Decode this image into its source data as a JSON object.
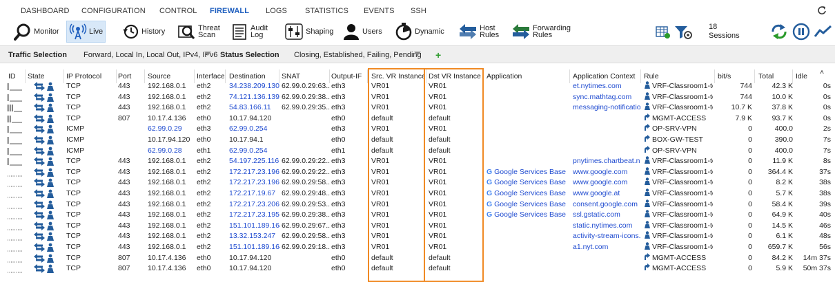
{
  "nav": {
    "items": [
      "DASHBOARD",
      "CONFIGURATION",
      "CONTROL",
      "FIREWALL",
      "LOGS",
      "STATISTICS",
      "EVENTS",
      "SSH"
    ],
    "active": "FIREWALL"
  },
  "toolbar": {
    "monitor": "Monitor",
    "live": "Live",
    "history": "History",
    "threat_scan_1": "Threat",
    "threat_scan_2": "Scan",
    "audit_log_1": "Audit",
    "audit_log_2": "Log",
    "shaping": "Shaping",
    "users": "Users",
    "dynamic": "Dynamic",
    "host_rules_1": "Host",
    "host_rules_2": "Rules",
    "forwarding_rules_1": "Forwarding",
    "forwarding_rules_2": "Rules",
    "sessions_count": "18",
    "sessions_label": "Sessions"
  },
  "filters": {
    "traffic_label": "Traffic Selection",
    "traffic_value": "Forward, Local In, Local Out, IPv4, IPv6",
    "status_label": "Status Selection",
    "status_value": "Closing, Established, Failing, Pending",
    "add": "+"
  },
  "columns": [
    "ID",
    "State",
    "IP Protocol",
    "Port",
    "Source",
    "Interface",
    "Destination",
    "SNAT",
    "Output-IF",
    "Src. VR Instance",
    "Dst VR Instance",
    "Application",
    "Application Context",
    "Rule",
    "bit/s",
    "Total",
    "Idle"
  ],
  "colors": {
    "accent_blue": "#1f4bd0",
    "highlight_orange": "#f08a24",
    "nav_active": "#1f5fbf"
  },
  "rows": [
    {
      "id_bars": 1,
      "proto": "TCP",
      "port": "443",
      "src": "192.168.0.1",
      "src_blue": false,
      "iface": "eth2",
      "dst": "34.238.209.130",
      "dst_blue": true,
      "snat": "62.99.0.29:63...",
      "out": "eth3",
      "srcvr": "VR01",
      "dstvr": "VR01",
      "app": "",
      "ctx": "et.nytimes.com",
      "rule": "VRF-Classroom1-to-I...",
      "rule_icon": "person",
      "bits": "744",
      "total": "42.3 K",
      "idle": "0s"
    },
    {
      "id_bars": 1,
      "proto": "TCP",
      "port": "443",
      "src": "192.168.0.1",
      "src_blue": false,
      "iface": "eth2",
      "dst": "74.121.136.139",
      "dst_blue": true,
      "snat": "62.99.0.29:38...",
      "out": "eth3",
      "srcvr": "VR01",
      "dstvr": "VR01",
      "app": "",
      "ctx": "sync.mathtag.com",
      "rule": "VRF-Classroom1-to-I...",
      "rule_icon": "person",
      "bits": "744",
      "total": "10.0 K",
      "idle": "0s"
    },
    {
      "id_bars": 3,
      "proto": "TCP",
      "port": "443",
      "src": "192.168.0.1",
      "src_blue": false,
      "iface": "eth2",
      "dst": "54.83.166.11",
      "dst_blue": true,
      "snat": "62.99.0.29:35...",
      "out": "eth3",
      "srcvr": "VR01",
      "dstvr": "VR01",
      "app": "",
      "ctx": "messaging-notification...",
      "rule": "VRF-Classroom1-to-I...",
      "rule_icon": "person",
      "bits": "10.7 K",
      "total": "37.8 K",
      "idle": "0s"
    },
    {
      "id_bars": 2,
      "proto": "TCP",
      "port": "807",
      "src": "10.17.4.136",
      "src_blue": false,
      "iface": "eth0",
      "dst": "10.17.94.120",
      "dst_blue": false,
      "snat": "",
      "out": "eth0",
      "srcvr": "default",
      "dstvr": "default",
      "app": "",
      "ctx": "",
      "rule": "MGMT-ACCESS",
      "rule_icon": "arrow",
      "bits": "7.9 K",
      "total": "93.7 K",
      "idle": "0s"
    },
    {
      "id_bars": 1,
      "proto": "ICMP",
      "port": "",
      "src": "62.99.0.29",
      "src_blue": true,
      "iface": "eth3",
      "dst": "62.99.0.254",
      "dst_blue": true,
      "snat": "",
      "out": "eth3",
      "srcvr": "VR01",
      "dstvr": "VR01",
      "app": "",
      "ctx": "",
      "rule": "OP-SRV-VPN",
      "rule_icon": "arrow",
      "bits": "0",
      "total": "400.0",
      "idle": "2s"
    },
    {
      "id_bars": 1,
      "proto": "ICMP",
      "port": "",
      "src": "10.17.94.120",
      "src_blue": false,
      "iface": "eth0",
      "dst": "10.17.94.1",
      "dst_blue": false,
      "snat": "",
      "out": "eth0",
      "srcvr": "default",
      "dstvr": "default",
      "app": "",
      "ctx": "",
      "rule": "BOX-GW-TEST",
      "rule_icon": "arrow",
      "bits": "0",
      "total": "390.0",
      "idle": "7s"
    },
    {
      "id_bars": 1,
      "proto": "ICMP",
      "port": "",
      "src": "62.99.0.28",
      "src_blue": true,
      "iface": "eth1",
      "dst": "62.99.0.254",
      "dst_blue": true,
      "snat": "",
      "out": "eth1",
      "srcvr": "default",
      "dstvr": "default",
      "app": "",
      "ctx": "",
      "rule": "OP-SRV-VPN",
      "rule_icon": "arrow",
      "bits": "0",
      "total": "400.0",
      "idle": "7s"
    },
    {
      "id_bars": 1,
      "proto": "TCP",
      "port": "443",
      "src": "192.168.0.1",
      "src_blue": false,
      "iface": "eth2",
      "dst": "54.197.225.116",
      "dst_blue": true,
      "snat": "62.99.0.29:22...",
      "out": "eth3",
      "srcvr": "VR01",
      "dstvr": "VR01",
      "app": "",
      "ctx": "pnytimes.chartbeat.net",
      "rule": "VRF-Classroom1-to-I...",
      "rule_icon": "person",
      "bits": "0",
      "total": "11.9 K",
      "idle": "8s"
    },
    {
      "id_bars": 0,
      "proto": "TCP",
      "port": "443",
      "src": "192.168.0.1",
      "src_blue": false,
      "iface": "eth2",
      "dst": "172.217.23.196",
      "dst_blue": true,
      "snat": "62.99.0.29:22...",
      "out": "eth3",
      "srcvr": "VR01",
      "dstvr": "VR01",
      "app": "Google Services Base",
      "ctx": "www.google.com",
      "rule": "VRF-Classroom1-to-I...",
      "rule_icon": "person",
      "bits": "0",
      "total": "364.4 K",
      "idle": "37s"
    },
    {
      "id_bars": 0,
      "proto": "TCP",
      "port": "443",
      "src": "192.168.0.1",
      "src_blue": false,
      "iface": "eth2",
      "dst": "172.217.23.196",
      "dst_blue": true,
      "snat": "62.99.0.29:58...",
      "out": "eth3",
      "srcvr": "VR01",
      "dstvr": "VR01",
      "app": "Google Services Base",
      "ctx": "www.google.com",
      "rule": "VRF-Classroom1-to-I...",
      "rule_icon": "person",
      "bits": "0",
      "total": "8.2 K",
      "idle": "38s"
    },
    {
      "id_bars": 0,
      "proto": "TCP",
      "port": "443",
      "src": "192.168.0.1",
      "src_blue": false,
      "iface": "eth2",
      "dst": "172.217.19.67",
      "dst_blue": true,
      "snat": "62.99.0.29:48...",
      "out": "eth3",
      "srcvr": "VR01",
      "dstvr": "VR01",
      "app": "Google Services Base",
      "ctx": "www.google.at",
      "rule": "VRF-Classroom1-to-I...",
      "rule_icon": "person",
      "bits": "0",
      "total": "5.7 K",
      "idle": "38s"
    },
    {
      "id_bars": 0,
      "proto": "TCP",
      "port": "443",
      "src": "192.168.0.1",
      "src_blue": false,
      "iface": "eth2",
      "dst": "172.217.23.206",
      "dst_blue": true,
      "snat": "62.99.0.29:53...",
      "out": "eth3",
      "srcvr": "VR01",
      "dstvr": "VR01",
      "app": "Google Services Base",
      "ctx": "consent.google.com",
      "rule": "VRF-Classroom1-to-I...",
      "rule_icon": "person",
      "bits": "0",
      "total": "58.4 K",
      "idle": "39s"
    },
    {
      "id_bars": 0,
      "proto": "TCP",
      "port": "443",
      "src": "192.168.0.1",
      "src_blue": false,
      "iface": "eth2",
      "dst": "172.217.23.195",
      "dst_blue": true,
      "snat": "62.99.0.29:38...",
      "out": "eth3",
      "srcvr": "VR01",
      "dstvr": "VR01",
      "app": "Google Services Base",
      "ctx": "ssl.gstatic.com",
      "rule": "VRF-Classroom1-to-I...",
      "rule_icon": "person",
      "bits": "0",
      "total": "64.9 K",
      "idle": "40s"
    },
    {
      "id_bars": 0,
      "proto": "TCP",
      "port": "443",
      "src": "192.168.0.1",
      "src_blue": false,
      "iface": "eth2",
      "dst": "151.101.189.164",
      "dst_blue": true,
      "snat": "62.99.0.29:67...",
      "out": "eth3",
      "srcvr": "VR01",
      "dstvr": "VR01",
      "app": "",
      "ctx": "static.nytimes.com",
      "rule": "VRF-Classroom1-to-I...",
      "rule_icon": "person",
      "bits": "0",
      "total": "14.5 K",
      "idle": "46s"
    },
    {
      "id_bars": 0,
      "proto": "TCP",
      "port": "443",
      "src": "192.168.0.1",
      "src_blue": false,
      "iface": "eth2",
      "dst": "13.32.153.247",
      "dst_blue": true,
      "snat": "62.99.0.29:58...",
      "out": "eth3",
      "srcvr": "VR01",
      "dstvr": "VR01",
      "app": "",
      "ctx": "activity-stream-icons.s...",
      "rule": "VRF-Classroom1-to-I...",
      "rule_icon": "person",
      "bits": "0",
      "total": "6.1 K",
      "idle": "48s"
    },
    {
      "id_bars": 0,
      "proto": "TCP",
      "port": "443",
      "src": "192.168.0.1",
      "src_blue": false,
      "iface": "eth2",
      "dst": "151.101.189.164",
      "dst_blue": true,
      "snat": "62.99.0.29:18...",
      "out": "eth3",
      "srcvr": "VR01",
      "dstvr": "VR01",
      "app": "",
      "ctx": "a1.nyt.com",
      "rule": "VRF-Classroom1-to-I...",
      "rule_icon": "person",
      "bits": "0",
      "total": "659.7 K",
      "idle": "56s"
    },
    {
      "id_bars": 0,
      "proto": "TCP",
      "port": "807",
      "src": "10.17.4.136",
      "src_blue": false,
      "iface": "eth0",
      "dst": "10.17.94.120",
      "dst_blue": false,
      "snat": "",
      "out": "eth0",
      "srcvr": "default",
      "dstvr": "default",
      "app": "",
      "ctx": "",
      "rule": "MGMT-ACCESS",
      "rule_icon": "arrow",
      "bits": "0",
      "total": "84.2 K",
      "idle": "14m 37s"
    },
    {
      "id_bars": 0,
      "proto": "TCP",
      "port": "807",
      "src": "10.17.4.136",
      "src_blue": false,
      "iface": "eth0",
      "dst": "10.17.94.120",
      "dst_blue": false,
      "snat": "",
      "out": "eth0",
      "srcvr": "default",
      "dstvr": "default",
      "app": "",
      "ctx": "",
      "rule": "MGMT-ACCESS",
      "rule_icon": "arrow",
      "bits": "0",
      "total": "5.9 K",
      "idle": "50m 37s"
    }
  ]
}
